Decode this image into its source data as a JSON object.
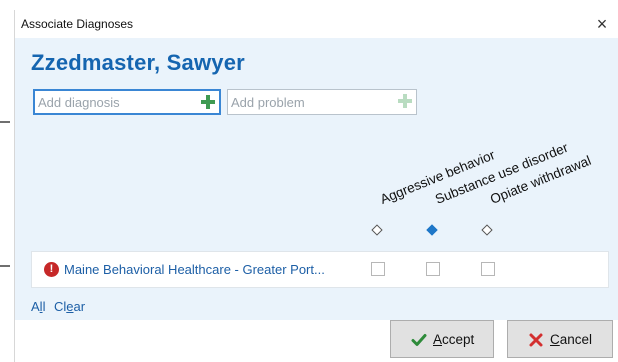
{
  "window": {
    "title": "Associate Diagnoses",
    "close_glyph": "×"
  },
  "patient": {
    "name": "Zzedmaster, Sawyer"
  },
  "diagnosis_input": {
    "placeholder": "Add diagnosis",
    "value": ""
  },
  "problem_input": {
    "placeholder": "Add problem",
    "value": ""
  },
  "columns": [
    {
      "label": "Aggressive behavior",
      "selected": false
    },
    {
      "label": "Substance use disorder",
      "selected": true
    },
    {
      "label": "Opiate withdrawal",
      "selected": false
    }
  ],
  "rows": [
    {
      "label": "Maine Behavioral Healthcare - Greater Port...",
      "checks": [
        false,
        false,
        false
      ]
    }
  ],
  "links": {
    "all_pre": "A",
    "all_underlined": "l",
    "all_post": "l",
    "clear_pre": "Cl",
    "clear_underlined": "e",
    "clear_post": "ar"
  },
  "buttons": {
    "accept_underlined": "A",
    "accept_rest": "ccept",
    "cancel_underlined": "C",
    "cancel_rest": "ancel"
  },
  "colors": {
    "accent": "#1565b0",
    "add_icon": "#3f9a52",
    "selected_diamond": "#1f77c8",
    "warning": "#c62828"
  }
}
